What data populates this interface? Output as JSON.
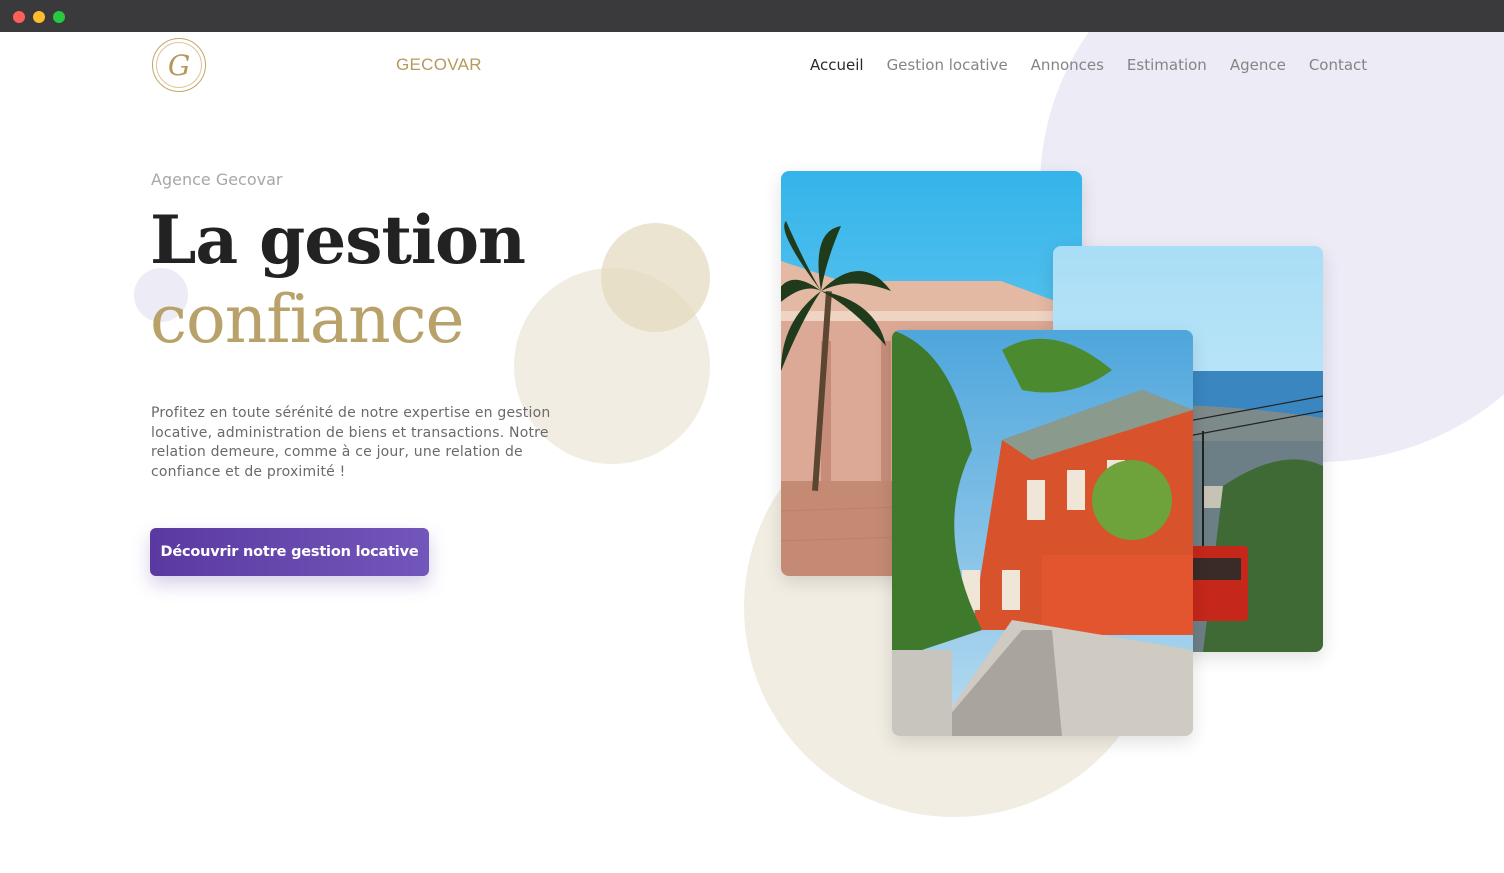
{
  "window": {
    "controls": [
      "close",
      "minimize",
      "maximize"
    ]
  },
  "header": {
    "logo_letter": "G",
    "brand": "GECOVAR",
    "nav": [
      {
        "label": "Accueil",
        "active": true
      },
      {
        "label": "Gestion locative",
        "active": false
      },
      {
        "label": "Annonces",
        "active": false
      },
      {
        "label": "Estimation",
        "active": false
      },
      {
        "label": "Agence",
        "active": false
      },
      {
        "label": "Contact",
        "active": false
      }
    ]
  },
  "hero": {
    "eyebrow": "Agence Gecovar",
    "title_line1": "La gestion",
    "title_line2": "confiance",
    "description": "Profitez en toute sérénité de notre expertise en gestion locative, administration de biens et transactions. Notre relation demeure, comme à ce jour, une relation de confiance et de proximité !",
    "cta_label": "Découvrir notre gestion locative"
  },
  "photos": [
    {
      "name": "palm-building-photo"
    },
    {
      "name": "cable-car-photo"
    },
    {
      "name": "red-house-street-photo"
    }
  ],
  "colors": {
    "accent_gold": "#b9a26a",
    "accent_purple": "#5a3aa0",
    "lavender": "#ecebf6",
    "beige": "#f1ede2"
  }
}
